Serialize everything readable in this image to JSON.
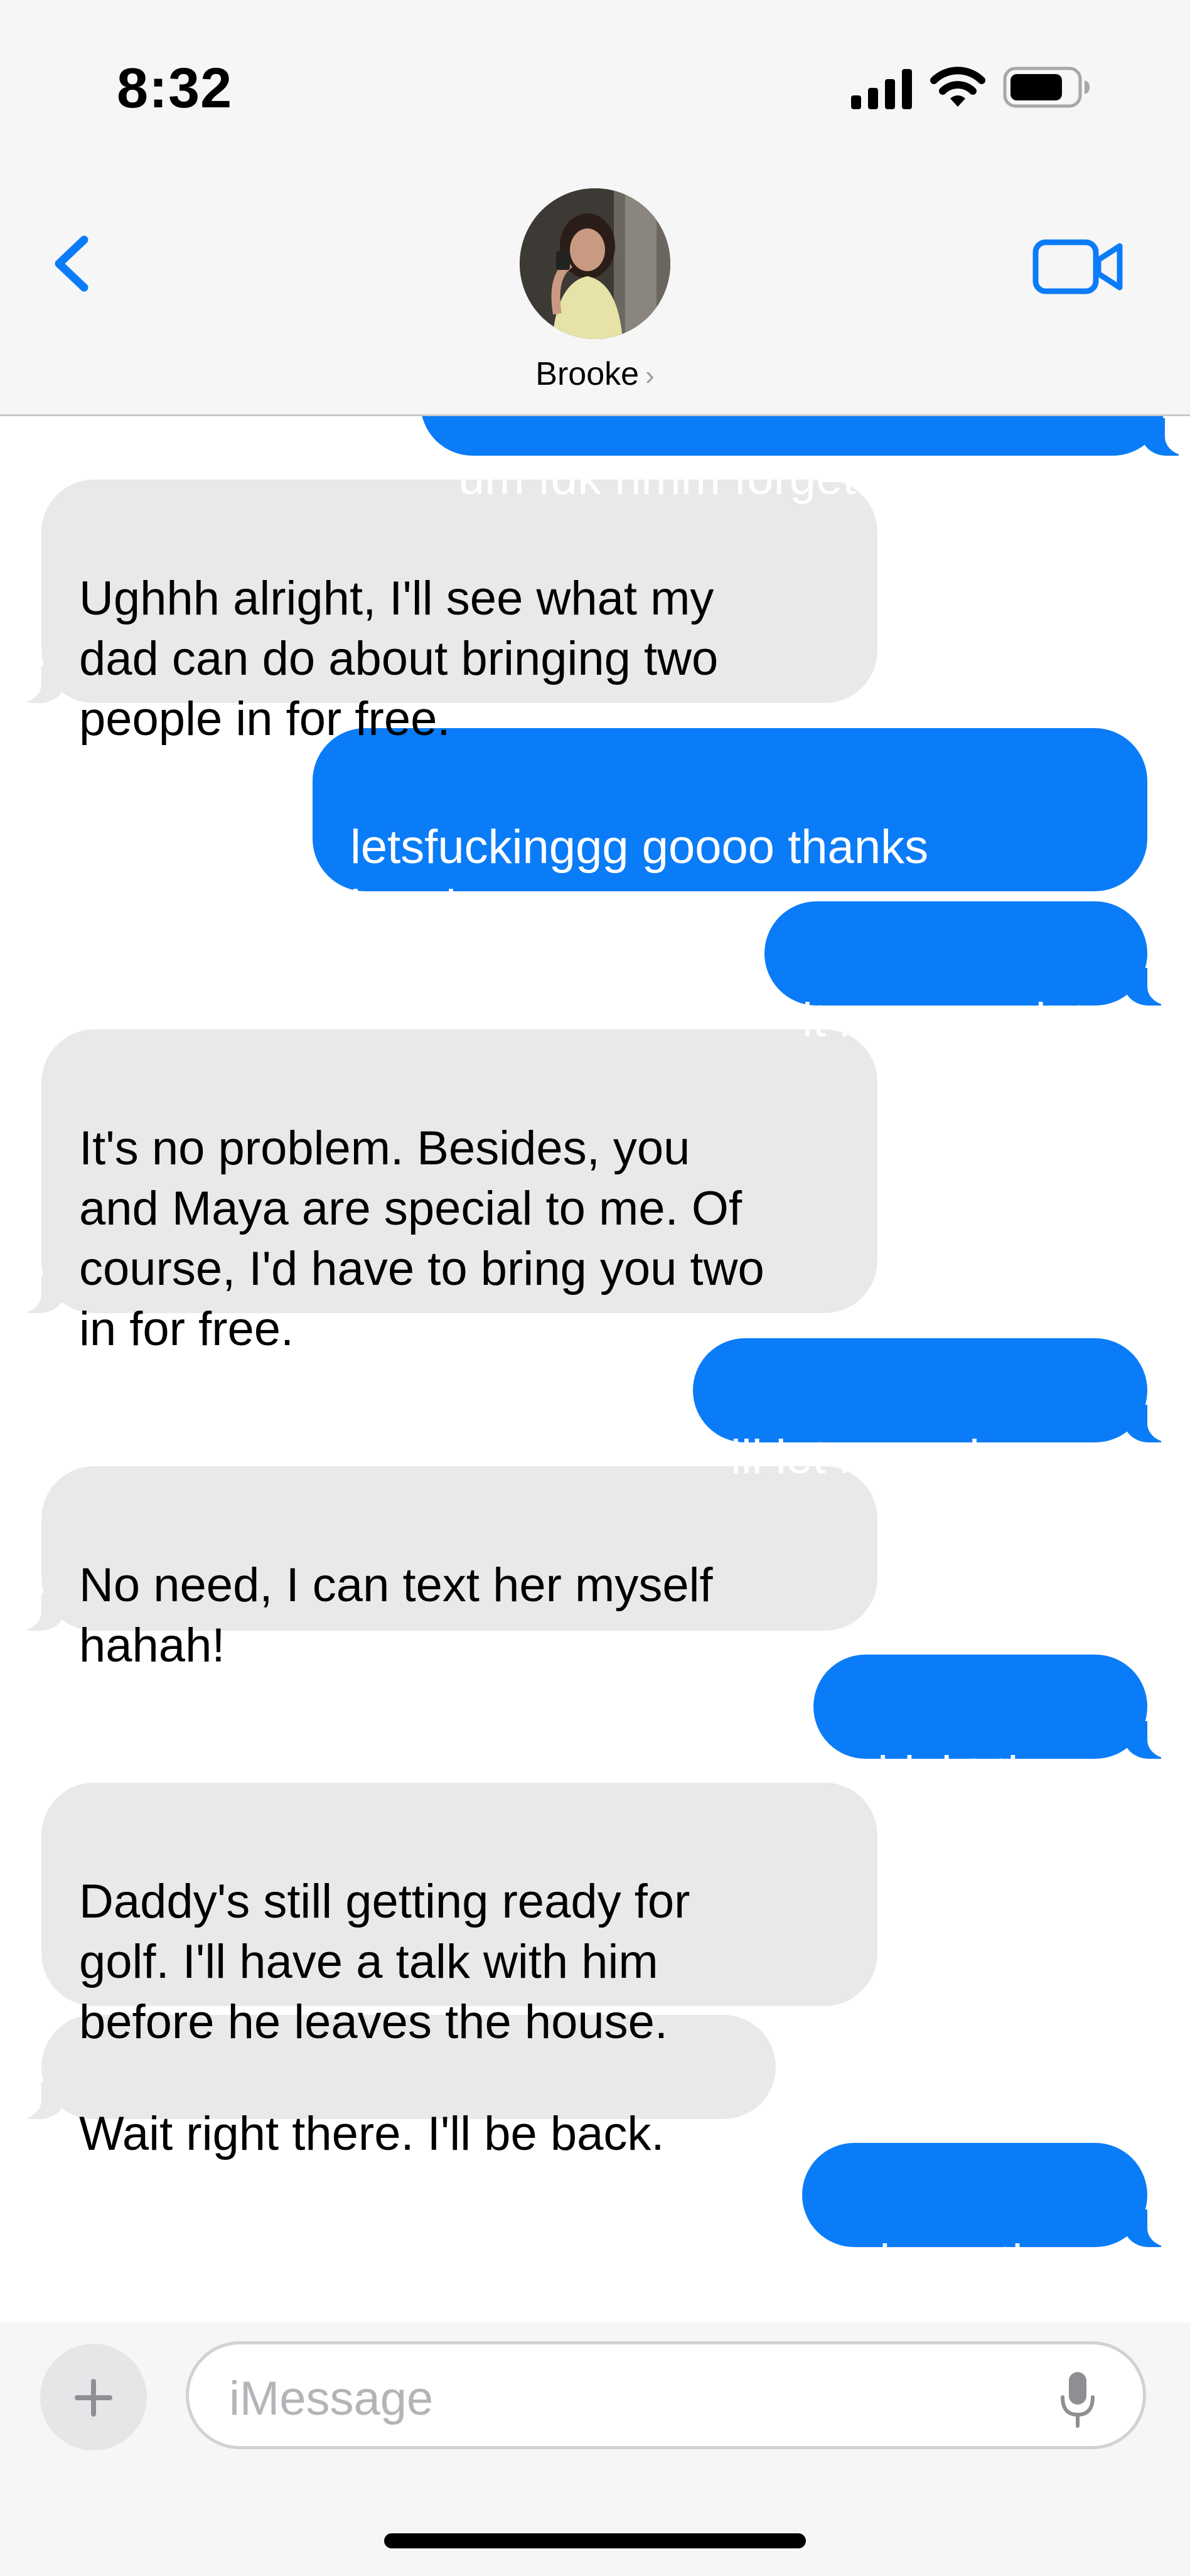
{
  "status_bar": {
    "time": "8:32"
  },
  "header": {
    "contact_name": "Brooke",
    "chevron": "›",
    "icons": {
      "back": "chevron-left-icon",
      "video": "video-camera-icon",
      "avatar": "contact-avatar"
    }
  },
  "colors": {
    "accent": "#0b7cf7",
    "incoming_bubble": "#e9e9eb",
    "header_bg": "#f6f6f6"
  },
  "messages": [
    {
      "direction": "outgoing",
      "text": "um fdk hmm forget I said that",
      "partial": true
    },
    {
      "direction": "incoming",
      "text": "Ughhh alright, I'll see what my\ndad can do about bringing two\npeople in for free."
    },
    {
      "direction": "outgoing",
      "text": "letsfuckinggg goooo thanks\nbrooke"
    },
    {
      "direction": "outgoing",
      "text": "it means a lot"
    },
    {
      "direction": "incoming",
      "text": "It's no problem. Besides, you\nand Maya are special to me. Of\ncourse, I'd have to bring you two\nin for free."
    },
    {
      "direction": "outgoing",
      "text": "ill let maya know"
    },
    {
      "direction": "incoming",
      "text": "No need, I can text her myself\nhahah!"
    },
    {
      "direction": "outgoing",
      "text": "alright then"
    },
    {
      "direction": "incoming",
      "text": "Daddy's still getting ready for\ngolf. I'll have a talk with him\nbefore he leaves the house."
    },
    {
      "direction": "incoming",
      "text": "Wait right there. I'll be back."
    },
    {
      "direction": "outgoing",
      "text": "take ur time"
    }
  ],
  "input": {
    "placeholder": "iMessage",
    "value": ""
  }
}
